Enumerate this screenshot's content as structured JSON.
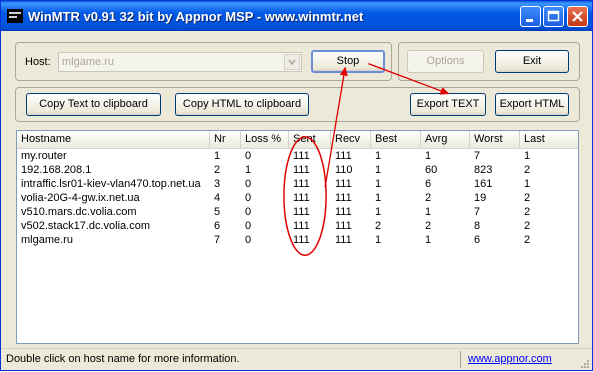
{
  "window": {
    "title": "WinMTR v0.91 32 bit by Appnor MSP - www.winmtr.net"
  },
  "toolbar": {
    "host_label": "Host:",
    "host_value": "mlgame.ru",
    "stop_label": "Stop",
    "options_label": "Options",
    "exit_label": "Exit",
    "copy_text_label": "Copy Text to clipboard",
    "copy_html_label": "Copy HTML to clipboard",
    "export_text_label": "Export TEXT",
    "export_html_label": "Export HTML"
  },
  "table": {
    "columns": [
      "Hostname",
      "Nr",
      "Loss %",
      "Sent",
      "Recv",
      "Best",
      "Avrg",
      "Worst",
      "Last"
    ],
    "rows": [
      [
        "my.router",
        "1",
        "0",
        "111",
        "111",
        "1",
        "1",
        "7",
        "1"
      ],
      [
        "192.168.208.1",
        "2",
        "1",
        "111",
        "110",
        "1",
        "60",
        "823",
        "2"
      ],
      [
        "intraffic.lsr01-kiev-vlan470.top.net.ua",
        "3",
        "0",
        "111",
        "111",
        "1",
        "6",
        "161",
        "1"
      ],
      [
        "volia-20G-4-gw.ix.net.ua",
        "4",
        "0",
        "111",
        "111",
        "1",
        "2",
        "19",
        "2"
      ],
      [
        "v510.mars.dc.volia.com",
        "5",
        "0",
        "111",
        "111",
        "1",
        "1",
        "7",
        "2"
      ],
      [
        "v502.stack17.dc.volia.com",
        "6",
        "0",
        "111",
        "111",
        "2",
        "2",
        "8",
        "2"
      ],
      [
        "mlgame.ru",
        "7",
        "0",
        "111",
        "111",
        "1",
        "1",
        "6",
        "2"
      ]
    ]
  },
  "status": {
    "message": "Double click on host name for more information.",
    "link": "www.appnor.com"
  },
  "colors": {
    "title_bar": "#0054e3",
    "annotation": "#e00000",
    "link": "#0000ff"
  }
}
